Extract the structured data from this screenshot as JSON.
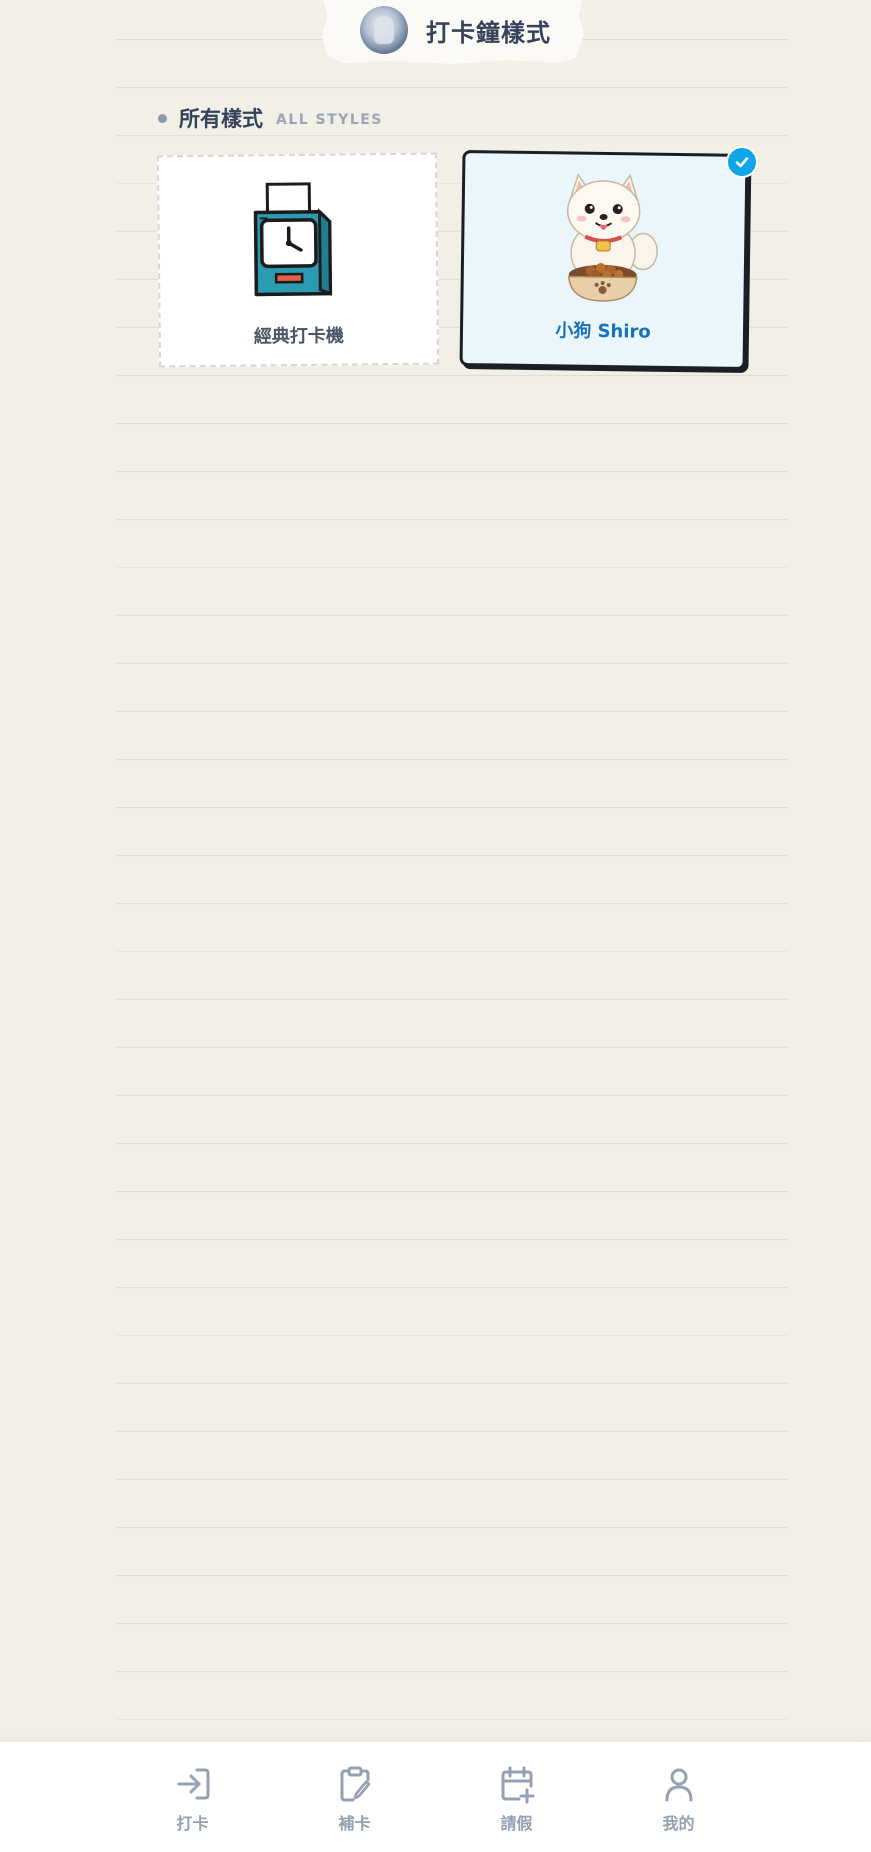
{
  "header": {
    "title": "打卡鐘樣式",
    "avatar": "avatar"
  },
  "section": {
    "title": "所有樣式",
    "subtitle": "ALL STYLES"
  },
  "styles": [
    {
      "label": "經典打卡機",
      "icon": "punch-clock-icon",
      "selected": false
    },
    {
      "label": "小狗 Shiro",
      "icon": "shiro-dog-icon",
      "selected": true
    }
  ],
  "colors": {
    "background": "#f2efe6",
    "accent": "#0ea5e9",
    "selected_label": "#1673b8",
    "nav_text": "#94a0b3"
  },
  "nav": {
    "items": [
      {
        "label": "打卡",
        "icon": "sign-in-icon"
      },
      {
        "label": "補卡",
        "icon": "clipboard-edit-icon"
      },
      {
        "label": "請假",
        "icon": "calendar-plus-icon"
      },
      {
        "label": "我的",
        "icon": "user-icon"
      }
    ]
  }
}
